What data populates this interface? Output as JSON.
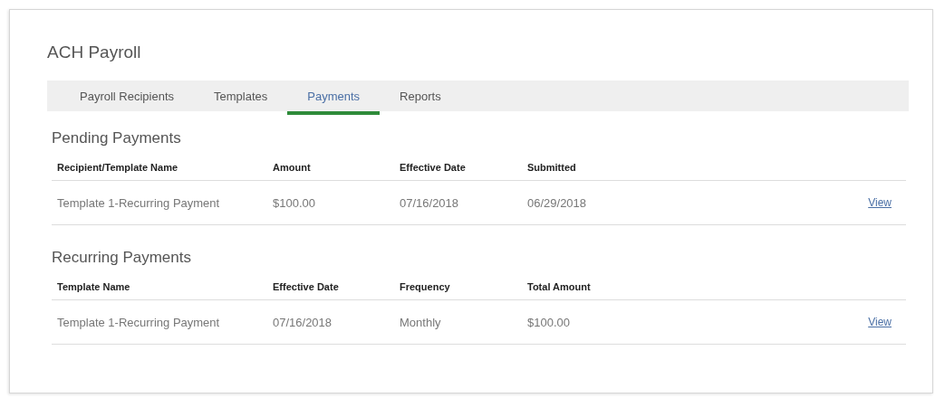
{
  "title": "ACH Payroll",
  "tabs": [
    {
      "label": "Payroll Recipients",
      "selected": false
    },
    {
      "label": "Templates",
      "selected": false
    },
    {
      "label": "Payments",
      "selected": true
    },
    {
      "label": "Reports",
      "selected": false
    }
  ],
  "sections": [
    {
      "heading": "Pending Payments",
      "columns": [
        "Recipient/Template Name",
        "Amount",
        "Effective Date",
        "Submitted"
      ],
      "rows": [
        {
          "cells": [
            "Template 1-Recurring Payment",
            "$100.00",
            "07/16/2018",
            "06/29/2018"
          ],
          "link": "View"
        }
      ]
    },
    {
      "heading": "Recurring Payments",
      "columns": [
        "Template Name",
        "Effective Date",
        "Frequency",
        "Total Amount"
      ],
      "rows": [
        {
          "cells": [
            "Template 1-Recurring Payment",
            "07/16/2018",
            "Monthly",
            "$100.00"
          ],
          "link": "View"
        }
      ]
    }
  ]
}
